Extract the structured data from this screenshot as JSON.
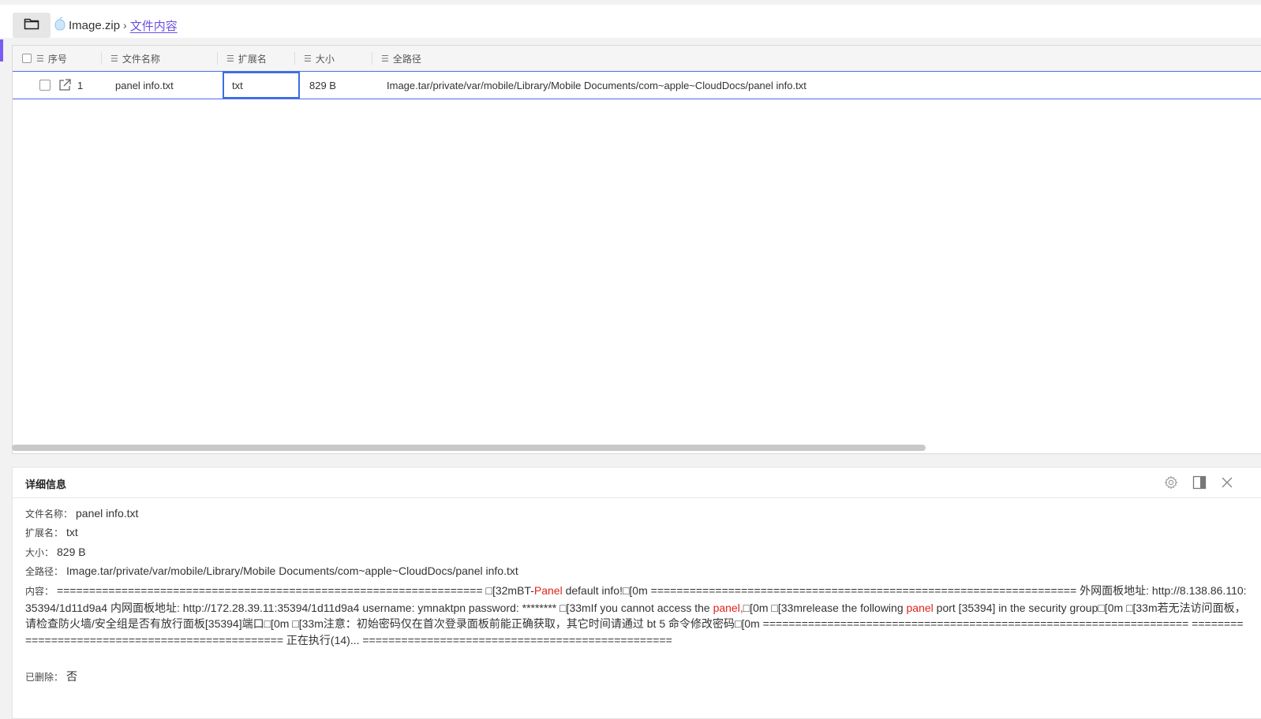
{
  "breadcrumb": {
    "root": "Image.zip",
    "separator": "›",
    "current": "文件内容"
  },
  "table": {
    "columns": [
      "序号",
      "文件名称",
      "扩展名",
      "大小",
      "全路径"
    ],
    "rows": [
      {
        "index": "1",
        "name": "panel info.txt",
        "ext": "txt",
        "size": "829 B",
        "path": "Image.tar/private/var/mobile/Library/Mobile Documents/com~apple~CloudDocs/panel info.txt"
      }
    ]
  },
  "detail": {
    "title": "详细信息",
    "name_label": "文件名称：",
    "name_value": "panel info.txt",
    "ext_label": "扩展名：",
    "ext_value": "txt",
    "size_label": "大小：",
    "size_value": "829 B",
    "path_label": "全路径：",
    "path_value": "Image.tar/private/var/mobile/Library/Mobile Documents/com~apple~CloudDocs/panel info.txt",
    "content_label": "内容：",
    "content": {
      "p1": "================================================================== □[32mBT-",
      "hl1": "Panel",
      "p2": " default info!□[0m ================================================================== 外网面板地址: http://8.138.86.110:35394/1d11d9a4 内网面板地址: http://172.28.39.11:35394/1d11d9a4 username: ymnaktpn password: ******** □[33mIf you cannot access the ",
      "hl2": "panel,",
      "p3": "□[0m □[33mrelease the following ",
      "hl3": "panel",
      "p4": " port [35394] in the security group□[0m □[33m若无法访问面板，请检查防火墙/安全组是否有放行面板[35394]端口□[0m □[33m注意：初始密码仅在首次登录面板前能正确获取，其它时间请通过 bt 5 命令修改密码□[0m ================================================================== ================================================ 正在执行(14)... ================================================"
    },
    "deleted_label": "已删除：",
    "deleted_value": "否"
  },
  "icons": {
    "folder": "folder-icon",
    "archive": "archive-icon",
    "column_menu": "column-menu-icon",
    "open": "open-external-icon",
    "settings": "gear-icon",
    "split": "panel-toggle-icon",
    "close": "close-icon"
  },
  "colors": {
    "accent": "#6c50e0",
    "selection": "#3b6fe0",
    "highlight": "#e0231b"
  }
}
